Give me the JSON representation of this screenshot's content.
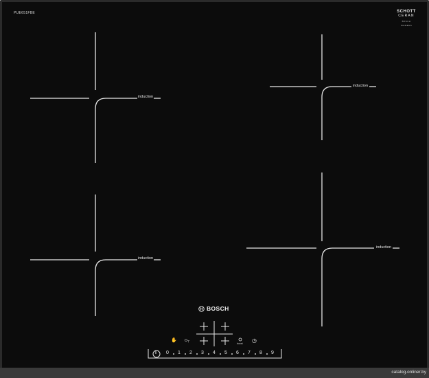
{
  "cooktop": {
    "model_code": "PUE651FBE",
    "brand": "BOSCH",
    "glass_logo": {
      "line1": "SCHOTT",
      "line2": "CERAN",
      "line3": "BOSCH SIEMENS"
    },
    "zones": [
      {
        "id": "front-left",
        "label": "induction"
      },
      {
        "id": "rear-left",
        "label": "induction"
      },
      {
        "id": "rear-right",
        "label": "induction"
      },
      {
        "id": "front-right",
        "label": "induction"
      }
    ],
    "controls": {
      "child_lock_glyph": "✋",
      "key_lock_glyph": "O┬",
      "boost_label": "boost",
      "timer_glyph": "◷",
      "power_glyph": "I",
      "slider_levels": [
        "0",
        "1",
        "2",
        "3",
        "4",
        "5",
        "6",
        "7",
        "8",
        "9"
      ]
    },
    "colors": {
      "glass": "#0c0c0c",
      "frame": "#2b2b2b",
      "marking": "#e8e8e8"
    }
  },
  "watermark": "catalog.onliner.by"
}
